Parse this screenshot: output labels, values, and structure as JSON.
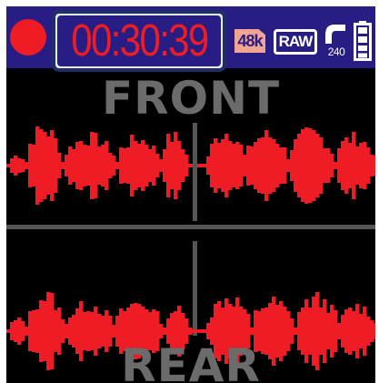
{
  "status_bar": {
    "recording_indicator": "recording-dot",
    "timer": "00:30:39",
    "sample_rate_badge": "48k",
    "format_badge": "RAW",
    "low_cut_value": "240",
    "battery_icon": "battery-icon"
  },
  "waveforms": {
    "front_label": "FRONT",
    "rear_label": "REAR"
  },
  "colors": {
    "statusbar_bg": "#281d84",
    "accent_red": "#ee1c25",
    "rate_badge": "#f0a493",
    "divider_gray": "#555555",
    "label_gray": "#6b6b6b"
  }
}
